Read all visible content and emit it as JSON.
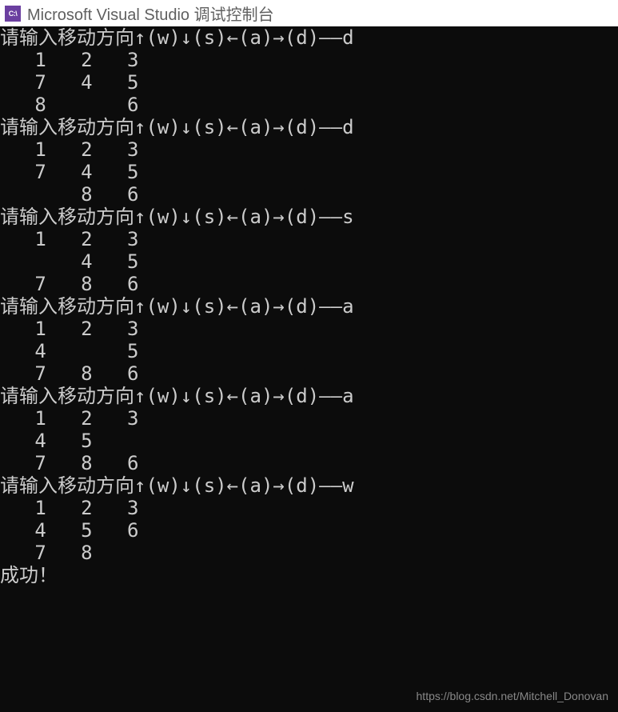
{
  "titlebar": {
    "icon_label": "C:\\",
    "title": "Microsoft Visual Studio 调试控制台"
  },
  "prompt_prefix": "请输入移动方向↑(w)↓(s)←(a)→(d)——",
  "moves": [
    {
      "input": "d",
      "grid": [
        [
          "1",
          "2",
          "3"
        ],
        [
          "7",
          "4",
          "5"
        ],
        [
          "8",
          " ",
          "6"
        ]
      ]
    },
    {
      "input": "d",
      "grid": [
        [
          "1",
          "2",
          "3"
        ],
        [
          "7",
          "4",
          "5"
        ],
        [
          " ",
          "8",
          "6"
        ]
      ]
    },
    {
      "input": "s",
      "grid": [
        [
          "1",
          "2",
          "3"
        ],
        [
          " ",
          "4",
          "5"
        ],
        [
          "7",
          "8",
          "6"
        ]
      ]
    },
    {
      "input": "a",
      "grid": [
        [
          "1",
          "2",
          "3"
        ],
        [
          "4",
          " ",
          "5"
        ],
        [
          "7",
          "8",
          "6"
        ]
      ]
    },
    {
      "input": "a",
      "grid": [
        [
          "1",
          "2",
          "3"
        ],
        [
          "4",
          "5",
          " "
        ],
        [
          "7",
          "8",
          "6"
        ]
      ]
    },
    {
      "input": "w",
      "grid": [
        [
          "1",
          "2",
          "3"
        ],
        [
          "4",
          "5",
          "6"
        ],
        [
          "7",
          "8",
          " "
        ]
      ]
    }
  ],
  "success_message": "成功！",
  "watermark": "https://blog.csdn.net/Mitchell_Donovan"
}
